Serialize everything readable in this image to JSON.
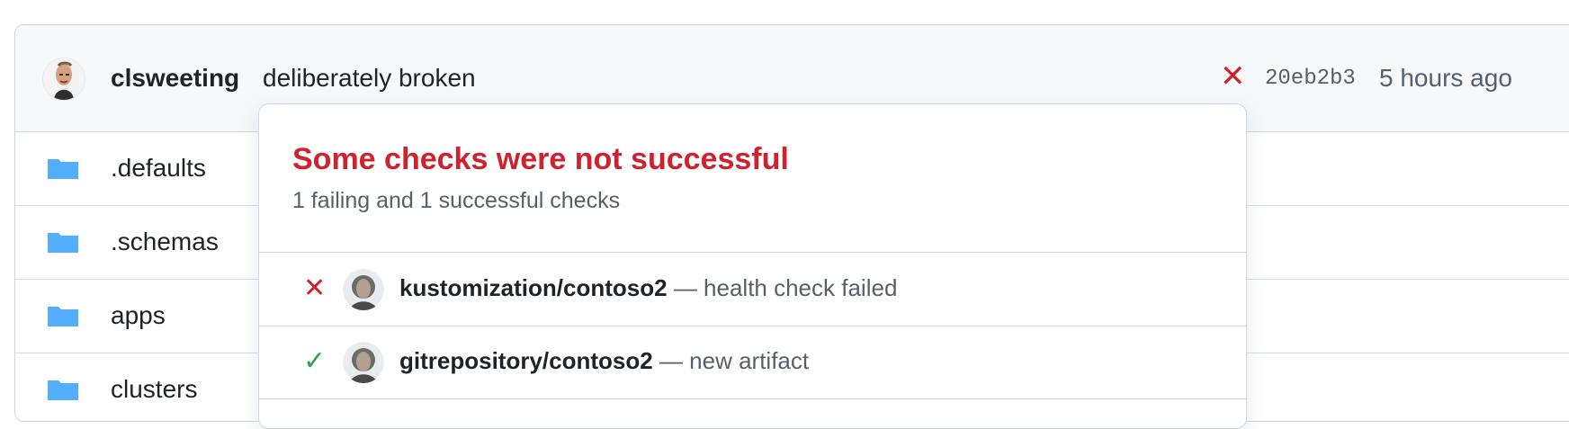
{
  "commit": {
    "author": "clsweeting",
    "message": "deliberately broken",
    "status_icon": "x-icon",
    "sha": "20eb2b3",
    "time": "5 hours ago",
    "status_color": "#cf222e"
  },
  "files": [
    {
      "name": ".defaults",
      "icon": "folder-icon"
    },
    {
      "name": ".schemas",
      "icon": "folder-icon"
    },
    {
      "name": "apps",
      "icon": "folder-icon"
    },
    {
      "name": "clusters",
      "icon": "folder-icon"
    }
  ],
  "checks_popover": {
    "title": "Some checks were not successful",
    "subtitle": "1 failing and 1 successful checks",
    "items": [
      {
        "status": "failure",
        "status_icon": "x-icon",
        "name": "kustomization/contoso2",
        "description": "— health check failed"
      },
      {
        "status": "success",
        "status_icon": "check-icon",
        "name": "gitrepository/contoso2",
        "description": "— new artifact"
      }
    ]
  },
  "colors": {
    "failure": "#cf222e",
    "success": "#2da44e",
    "folder": "#54aeff",
    "muted_text": "#57606a"
  }
}
